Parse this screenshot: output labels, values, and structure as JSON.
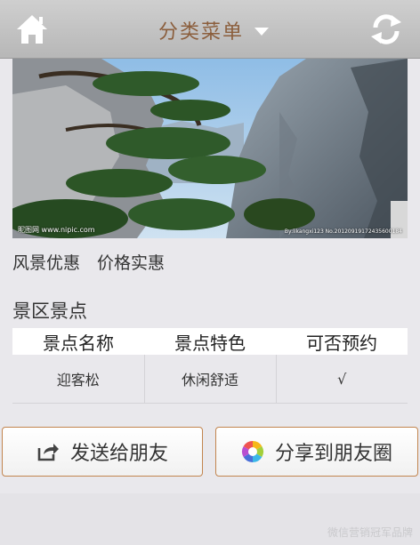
{
  "header": {
    "title": "分类菜单",
    "home_icon": "home-icon",
    "refresh_icon": "refresh-icon",
    "dropdown_icon": "caret-down-icon"
  },
  "hero": {
    "watermark_left": "昵图网 www.nipic.com",
    "watermark_right": "By:likangxi123 No.20120919172435600184"
  },
  "promo_text": "风景优惠　价格实惠",
  "section": {
    "title": "景区景点"
  },
  "table": {
    "headers": [
      "景点名称",
      "景点特色",
      "可否预约"
    ],
    "rows": [
      [
        "迎客松",
        "休闲舒适",
        "√"
      ]
    ]
  },
  "buttons": {
    "send_friend": "发送给朋友",
    "send_friend_icon": "share-icon",
    "share_moments": "分享到朋友圈",
    "share_moments_icon": "moments-aperture-icon"
  },
  "footer_watermark": "微信营销冠军品牌",
  "colors": {
    "header_bg": "#c4c4c4",
    "title_color": "#8b5e3c",
    "button_border": "#c2854f",
    "page_bg": "#e9e8ec"
  }
}
